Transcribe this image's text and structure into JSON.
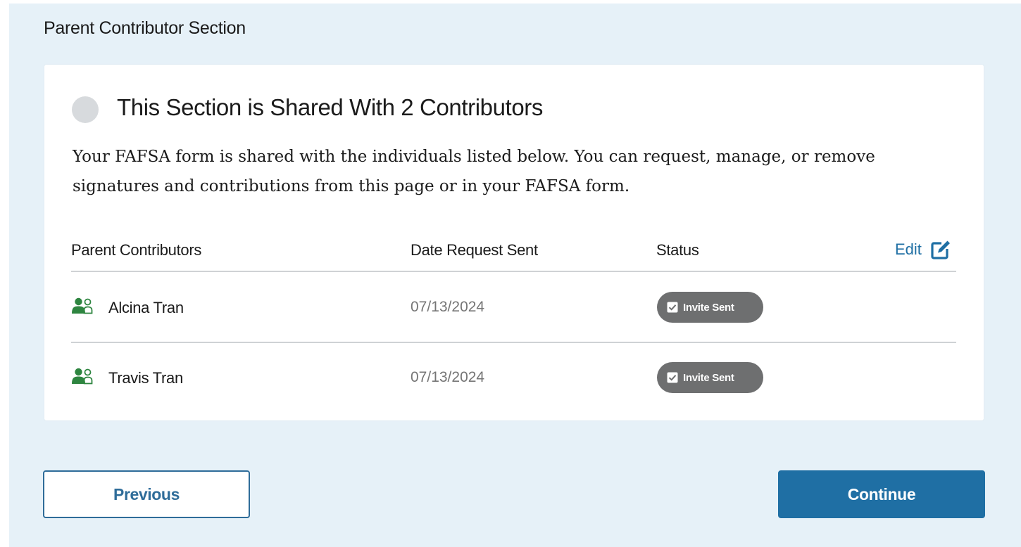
{
  "section_title": "Parent Contributor Section",
  "card": {
    "heading": "This Section is Shared With 2 Contributors",
    "description": "Your FAFSA form is shared with the individuals listed below. You can request, manage, or remove signatures and contributions from this page or in your FAFSA form."
  },
  "table": {
    "headers": {
      "contributors": "Parent Contributors",
      "date": "Date Request Sent",
      "status": "Status"
    },
    "edit_label": "Edit",
    "rows": [
      {
        "name": "Alcina Tran",
        "date": "07/13/2024",
        "status": "Invite Sent"
      },
      {
        "name": "Travis Tran",
        "date": "07/13/2024",
        "status": "Invite Sent"
      }
    ]
  },
  "buttons": {
    "previous": "Previous",
    "continue": "Continue"
  },
  "colors": {
    "background": "#e6f1f8",
    "accent": "#1f6fa4",
    "contributor_icon": "#2e8540",
    "badge": "#6e6f70"
  },
  "icons": {
    "edit": "edit-icon",
    "contributor": "users-icon",
    "status_check": "checkbox-check-icon"
  }
}
